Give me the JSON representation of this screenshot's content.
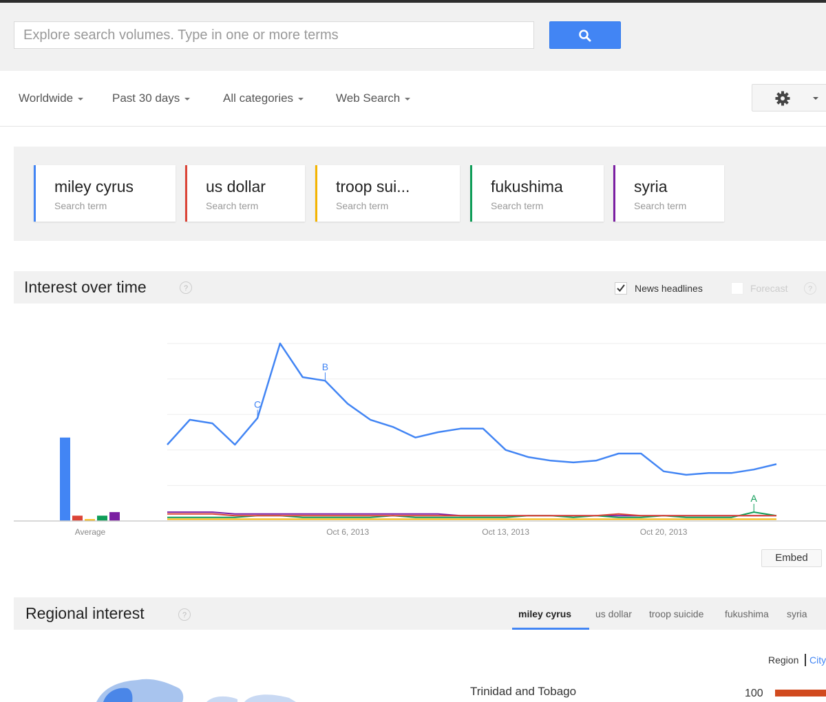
{
  "search": {
    "placeholder": "Explore search volumes. Type in one or more terms"
  },
  "filters": [
    {
      "label": "Worldwide"
    },
    {
      "label": "Past 30 days"
    },
    {
      "label": "All categories"
    },
    {
      "label": "Web Search"
    }
  ],
  "terms": [
    {
      "name": "miley cyrus",
      "sub": "Search term",
      "color": "#4285f4"
    },
    {
      "name": "us dollar",
      "sub": "Search term",
      "color": "#db4437"
    },
    {
      "name": "troop sui...",
      "sub": "Search term",
      "color": "#f4b400"
    },
    {
      "name": "fukushima",
      "sub": "Search term",
      "color": "#0f9d58"
    },
    {
      "name": "syria",
      "sub": "Search term",
      "color": "#7b1fa2"
    }
  ],
  "interest": {
    "title": "Interest over time",
    "help": "?",
    "news_label": "News headlines",
    "news_checked": true,
    "forecast_label": "Forecast",
    "forecast_checked": false,
    "embed_label": "Embed"
  },
  "chart_data": {
    "type": "line",
    "x": [
      "Sep 28, 2013",
      "Sep 29, 2013",
      "Sep 30, 2013",
      "Oct 1, 2013",
      "Oct 2, 2013",
      "Oct 3, 2013",
      "Oct 4, 2013",
      "Oct 5, 2013",
      "Oct 6, 2013",
      "Oct 7, 2013",
      "Oct 8, 2013",
      "Oct 9, 2013",
      "Oct 10, 2013",
      "Oct 11, 2013",
      "Oct 12, 2013",
      "Oct 13, 2013",
      "Oct 14, 2013",
      "Oct 15, 2013",
      "Oct 16, 2013",
      "Oct 17, 2013",
      "Oct 18, 2013",
      "Oct 19, 2013",
      "Oct 20, 2013",
      "Oct 21, 2013",
      "Oct 22, 2013",
      "Oct 23, 2013",
      "Oct 24, 2013",
      "Oct 25, 2013"
    ],
    "x_ticks": [
      "Oct 6, 2013",
      "Oct 13, 2013",
      "Oct 20, 2013"
    ],
    "average_label": "Average",
    "ylim": [
      0,
      100
    ],
    "grid": true,
    "series": [
      {
        "name": "miley cyrus",
        "color": "#4285f4",
        "average": 47,
        "values": [
          43,
          57,
          55,
          43,
          58,
          100,
          81,
          79,
          66,
          57,
          53,
          47,
          50,
          52,
          52,
          40,
          36,
          34,
          33,
          34,
          38,
          38,
          28,
          26,
          27,
          27,
          29,
          32
        ]
      },
      {
        "name": "us dollar",
        "color": "#db4437",
        "average": 3,
        "values": [
          4,
          4,
          4,
          3,
          3,
          3,
          3,
          3,
          3,
          3,
          3,
          3,
          3,
          3,
          3,
          3,
          3,
          3,
          3,
          3,
          4,
          3,
          3,
          3,
          3,
          3,
          3,
          3
        ]
      },
      {
        "name": "troop suicide",
        "color": "#f4b400",
        "average": 1,
        "values": [
          1,
          1,
          1,
          1,
          1,
          1,
          1,
          1,
          1,
          1,
          1,
          1,
          1,
          1,
          1,
          1,
          1,
          1,
          1,
          1,
          1,
          1,
          1,
          1,
          1,
          1,
          1,
          1
        ]
      },
      {
        "name": "fukushima",
        "color": "#0f9d58",
        "average": 3,
        "values": [
          2,
          2,
          2,
          2,
          3,
          3,
          2,
          2,
          2,
          2,
          3,
          2,
          2,
          2,
          2,
          2,
          3,
          3,
          2,
          3,
          2,
          2,
          3,
          2,
          2,
          2,
          5,
          3
        ]
      },
      {
        "name": "syria",
        "color": "#7b1fa2",
        "average": 5,
        "values": [
          5,
          5,
          5,
          4,
          4,
          4,
          4,
          4,
          4,
          4,
          4,
          4,
          4,
          3,
          3,
          3,
          3,
          3,
          3,
          3,
          3,
          3,
          3,
          3,
          3,
          3,
          3,
          3
        ]
      }
    ],
    "annotations": [
      {
        "label": "C",
        "series": "miley cyrus",
        "x": "Oct 2, 2013"
      },
      {
        "label": "B",
        "series": "miley cyrus",
        "x": "Oct 5, 2013"
      },
      {
        "label": "A",
        "series": "fukushima",
        "x": "Oct 24, 2013"
      }
    ]
  },
  "regional": {
    "title": "Regional interest",
    "help": "?",
    "tabs": [
      "miley cyrus",
      "us dollar",
      "troop suicide",
      "fukushima",
      "syria"
    ],
    "region_label": "Region",
    "city_label": "City",
    "top_country": "Trinidad and Tobago",
    "top_value": "100",
    "bar_color": "#d14a1e"
  }
}
